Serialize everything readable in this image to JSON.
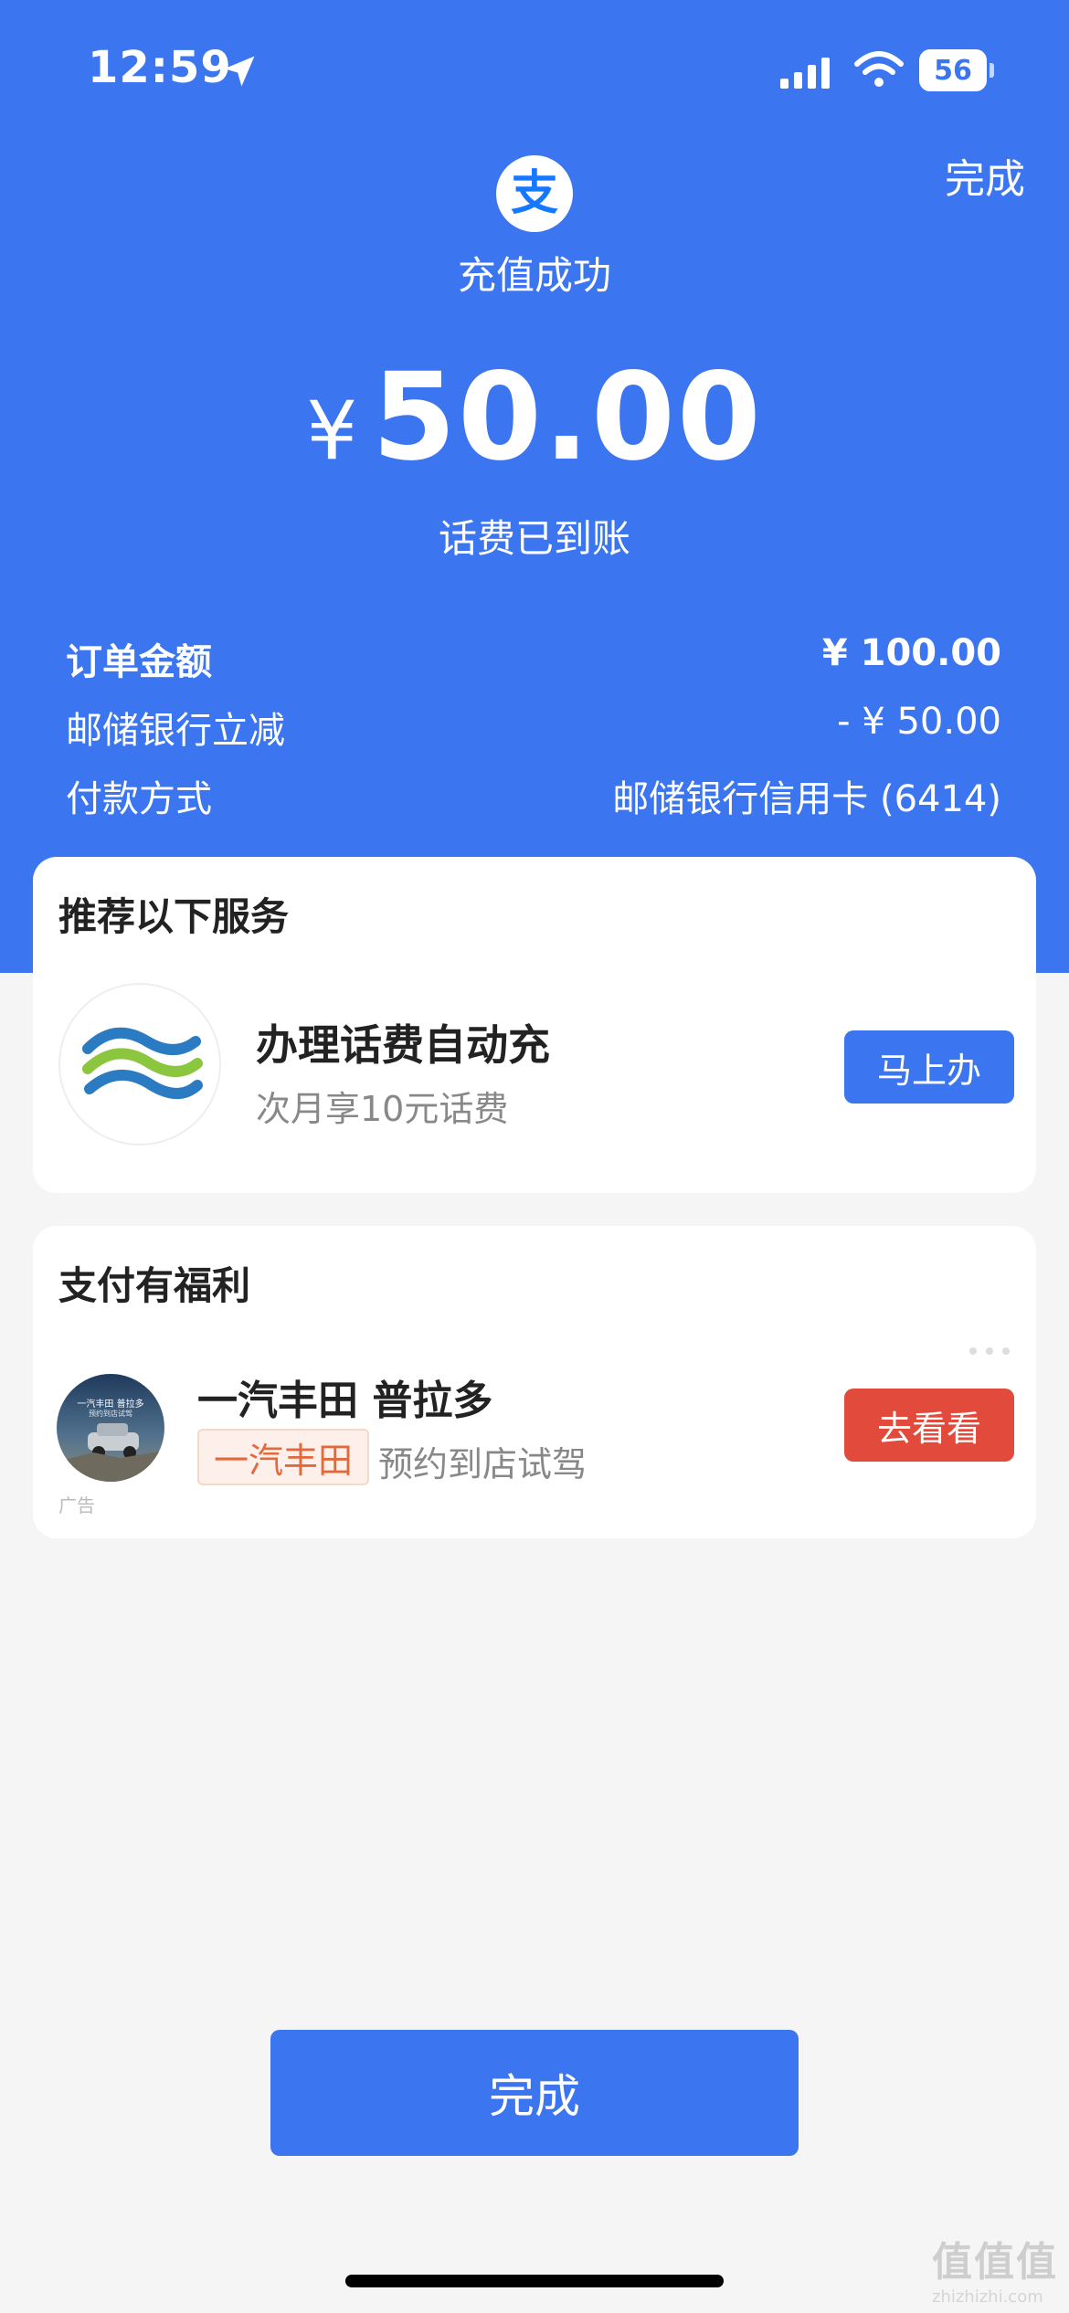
{
  "status_bar": {
    "time": "12:59",
    "battery": "56"
  },
  "header": {
    "done_label": "完成",
    "logo_char": "支",
    "title": "充值成功",
    "currency": "¥",
    "amount": "50.00",
    "subtitle": "话费已到账"
  },
  "details": [
    {
      "label": "订单金额",
      "value": "¥ 100.00"
    },
    {
      "label": "邮储银行立减",
      "value": "- ¥ 50.00"
    },
    {
      "label": "付款方式",
      "value": "邮储银行信用卡 (6414)"
    }
  ],
  "recommend": {
    "title": "推荐以下服务",
    "service_title": "办理话费自动充",
    "service_subtitle": "次月享10元话费",
    "button": "马上办"
  },
  "benefit": {
    "title": "支付有福利",
    "ad_title": "一汽丰田 普拉多",
    "brand_tag": "一汽丰田",
    "ad_desc": "预约到店试驾",
    "button": "去看看",
    "ad_label": "广告",
    "avatar_text": "一汽丰田 普拉多",
    "avatar_sub": "预约到店试驾"
  },
  "footer": {
    "done_button": "完成"
  },
  "watermark": {
    "logo": "值值值",
    "text": "zhizhizhi.com"
  },
  "colors": {
    "primary": "#3b76f0",
    "danger": "#e24a3b",
    "tag": "#e2693c"
  }
}
